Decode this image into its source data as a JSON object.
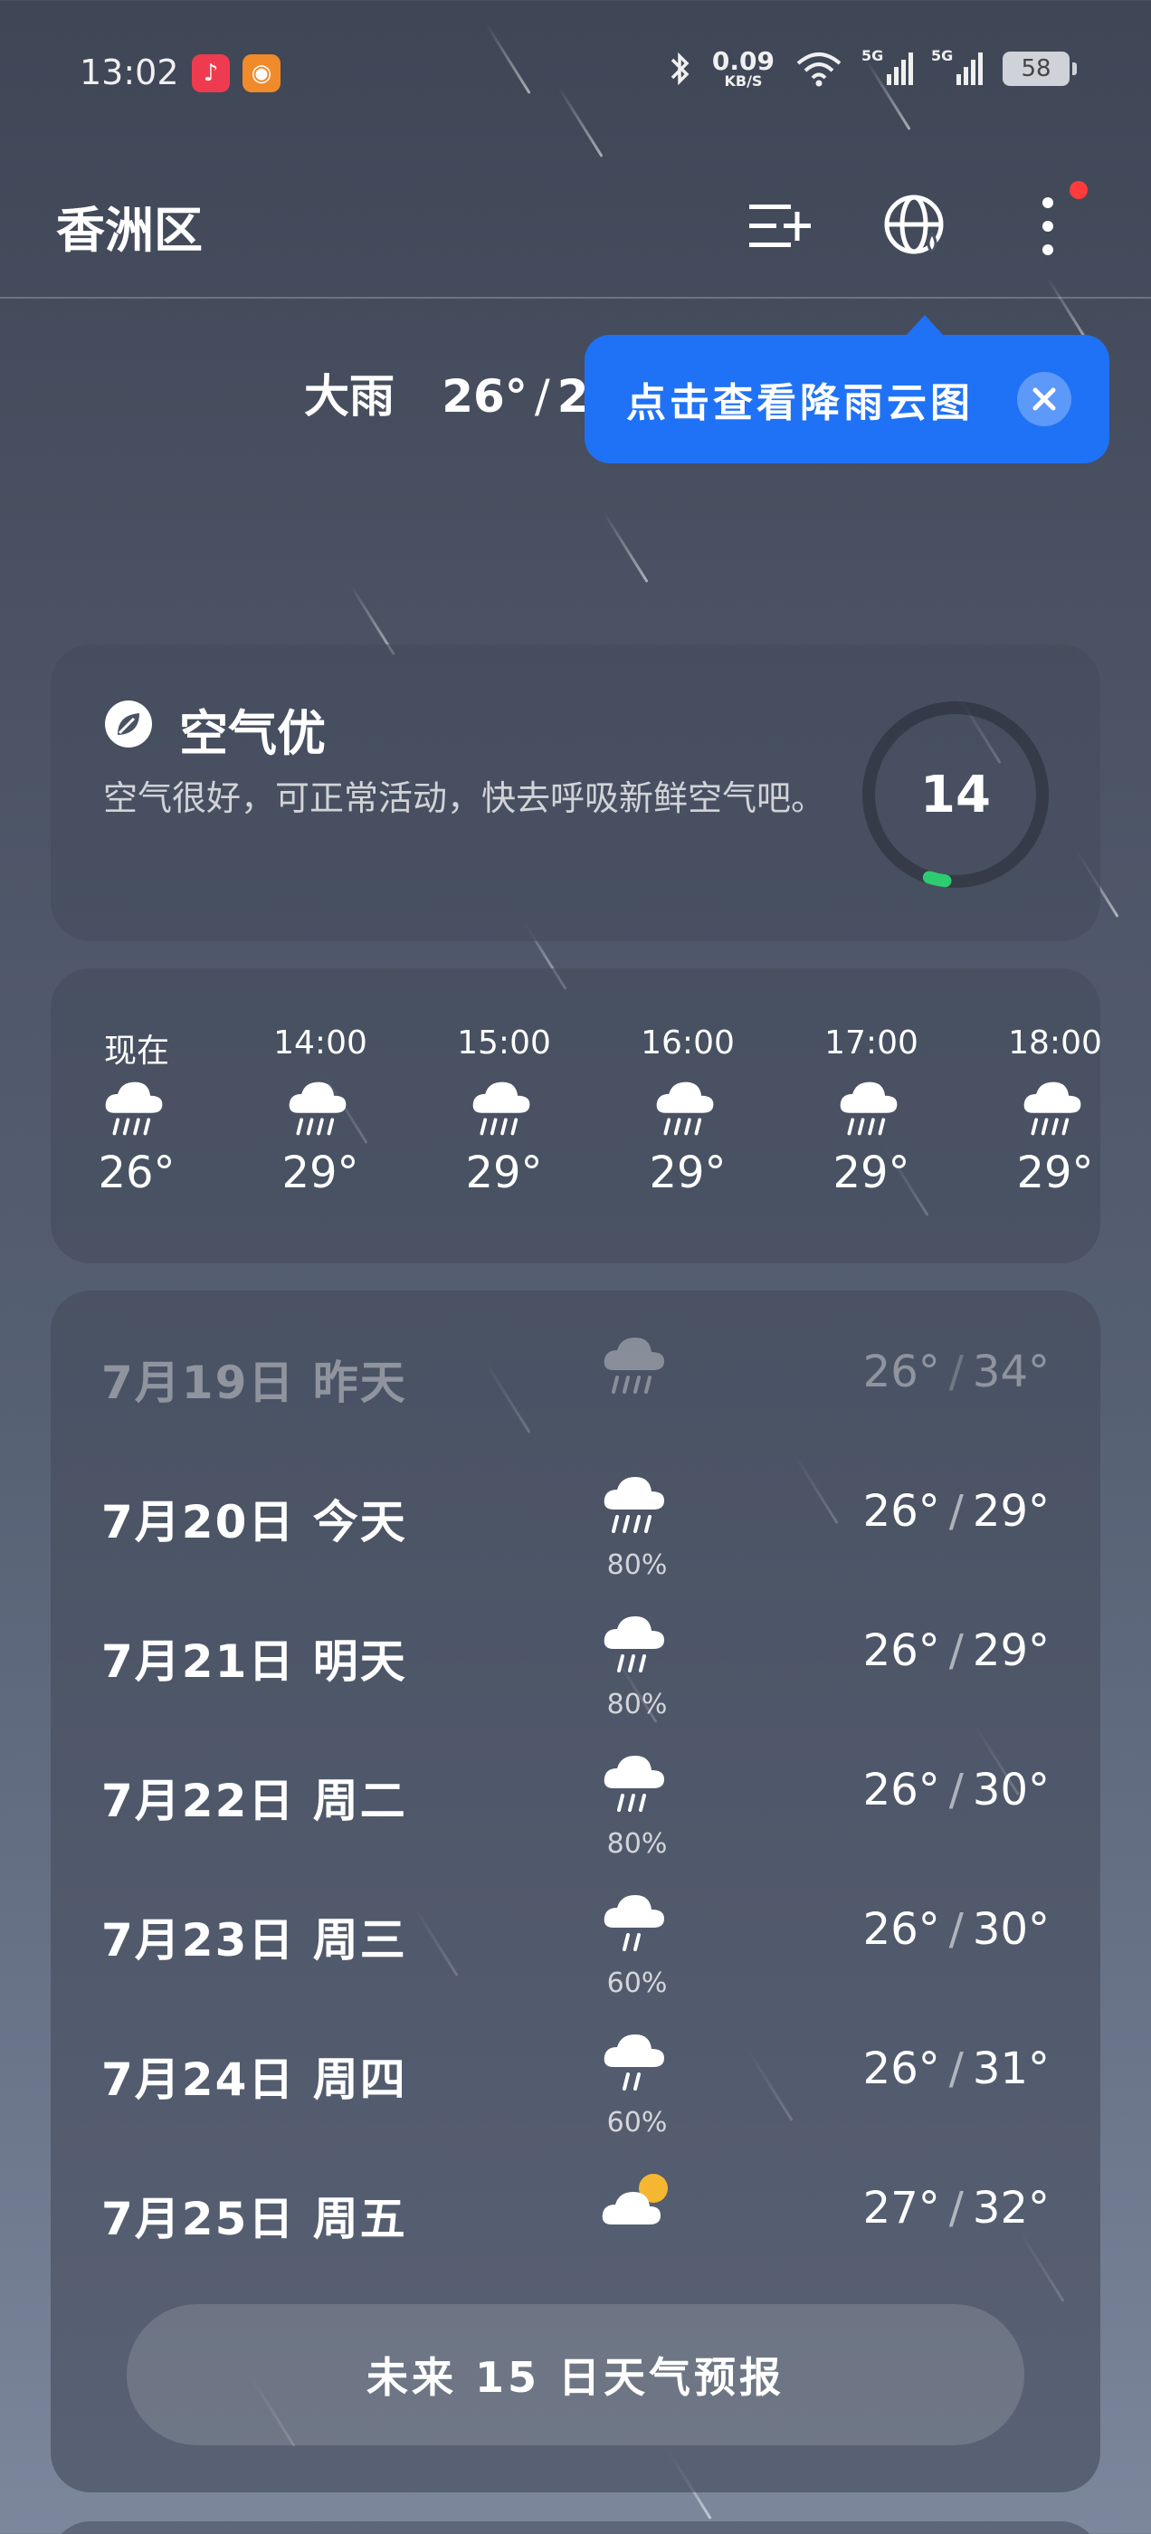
{
  "status_bar": {
    "time": "13:02",
    "net_speed_value": "0.09",
    "net_speed_unit": "KB/S",
    "signal_1": "5G",
    "signal_2": "5G",
    "battery": "58"
  },
  "header": {
    "location": "香洲区"
  },
  "tooltip": {
    "text": "点击查看降雨云图"
  },
  "current": {
    "condition": "大雨",
    "low": "26°",
    "high": "29°"
  },
  "aqi": {
    "title": "空气优",
    "description": "空气很好，可正常活动，快去呼吸新鲜空气吧。",
    "value": "14",
    "level_fraction": 0.03,
    "ring_color": "#2ecc71"
  },
  "hourly": [
    {
      "label": "现在",
      "temp": "26°",
      "icon": "heavy-rain-icon"
    },
    {
      "label": "14:00",
      "temp": "29°",
      "icon": "heavy-rain-icon"
    },
    {
      "label": "15:00",
      "temp": "29°",
      "icon": "heavy-rain-icon"
    },
    {
      "label": "16:00",
      "temp": "29°",
      "icon": "heavy-rain-icon"
    },
    {
      "label": "17:00",
      "temp": "29°",
      "icon": "heavy-rain-icon"
    },
    {
      "label": "18:00",
      "temp": "29°",
      "icon": "heavy-rain-icon"
    }
  ],
  "daily": [
    {
      "date": "7月19日",
      "day": "昨天",
      "icon": "heavy-rain-icon",
      "prob": "",
      "low": "26°",
      "high": "34°",
      "past": true
    },
    {
      "date": "7月20日",
      "day": "今天",
      "icon": "heavy-rain-icon",
      "prob": "80%",
      "low": "26°",
      "high": "29°",
      "past": false
    },
    {
      "date": "7月21日",
      "day": "明天",
      "icon": "moderate-rain-icon",
      "prob": "80%",
      "low": "26°",
      "high": "29°",
      "past": false
    },
    {
      "date": "7月22日",
      "day": "周二",
      "icon": "moderate-rain-icon",
      "prob": "80%",
      "low": "26°",
      "high": "30°",
      "past": false
    },
    {
      "date": "7月23日",
      "day": "周三",
      "icon": "light-rain-icon",
      "prob": "60%",
      "low": "26°",
      "high": "30°",
      "past": false
    },
    {
      "date": "7月24日",
      "day": "周四",
      "icon": "light-rain-icon",
      "prob": "60%",
      "low": "26°",
      "high": "31°",
      "past": false
    },
    {
      "date": "7月25日",
      "day": "周五",
      "icon": "partly-cloudy-icon",
      "prob": "",
      "low": "27°",
      "high": "32°",
      "past": false
    }
  ],
  "forecast_button": "未来 15 日天气预报",
  "colors": {
    "tooltip_bg": "#1f72f5",
    "alert_dot": "#ff3b3b",
    "sun": "#f5b731"
  }
}
